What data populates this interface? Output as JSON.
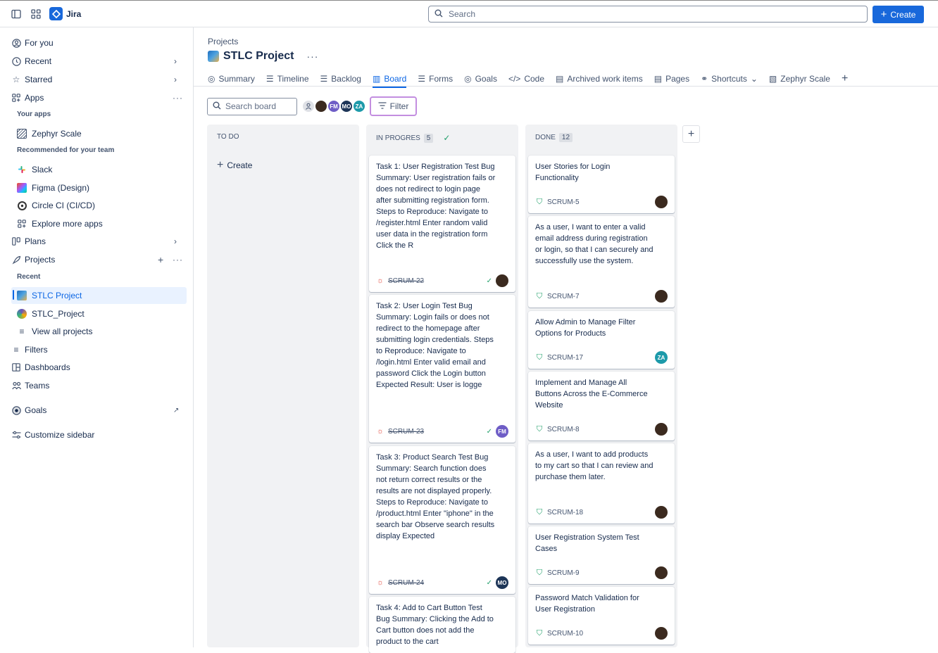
{
  "topbar": {
    "app_name": "Jira",
    "search_placeholder": "Search",
    "create_label": "Create"
  },
  "sidebar": {
    "items": {
      "for_you": "For you",
      "recent": "Recent",
      "starred": "Starred",
      "apps": "Apps",
      "your_apps_heading": "Your apps",
      "zephyr": "Zephyr Scale",
      "recommended_heading": "Recommended for your team",
      "slack": "Slack",
      "figma": "Figma (Design)",
      "circle": "Circle CI (CI/CD)",
      "explore": "Explore more apps",
      "plans": "Plans",
      "projects": "Projects",
      "recent_heading": "Recent",
      "stlc_project": "STLC Project",
      "stlc_project2": "STLC_Project",
      "view_all": "View all projects",
      "filters": "Filters",
      "dashboards": "Dashboards",
      "teams": "Teams",
      "goals": "Goals",
      "customize": "Customize sidebar"
    }
  },
  "header": {
    "breadcrumb": "Projects",
    "title": "STLC Project",
    "tabs": [
      "Summary",
      "Timeline",
      "Backlog",
      "Board",
      "Forms",
      "Goals",
      "Code",
      "Archived work items",
      "Pages",
      "Shortcuts",
      "Zephyr Scale"
    ],
    "active_tab": "Board"
  },
  "toolbar": {
    "search_placeholder": "Search board",
    "avatars": [
      "FM",
      "MO",
      "ZA"
    ],
    "filter_label": "Filter"
  },
  "board": {
    "columns": [
      {
        "title": "TO DO",
        "count": "",
        "create_label": "Create"
      },
      {
        "title": "IN PROGRES",
        "count": "5"
      },
      {
        "title": "DONE",
        "count": "12"
      }
    ],
    "in_progress_cards": [
      {
        "summary": "Task 1: User Registration Test Bug Summary: User registration fails or does not redirect to login page after submitting registration form. Steps to Reproduce: Navigate to /register.html Enter random valid user data in the registration form Click the R",
        "key": "SCRUM-22",
        "assignee": ""
      },
      {
        "summary": "Task 2: User Login Test Bug Summary: Login fails or does not redirect to the homepage after submitting login credentials. Steps to Reproduce: Navigate to /login.html Enter valid email and password Click the Login button Expected Result: User is logge",
        "key": "SCRUM-23",
        "assignee": "FM"
      },
      {
        "summary": "Task 3: Product Search Test Bug Summary: Search function does not return correct results or the results are not displayed properly. Steps to Reproduce: Navigate to /product.html Enter \"iphone\" in the search bar Observe search results display Expected",
        "key": "SCRUM-24",
        "assignee": "MO"
      },
      {
        "summary": "Task 4: Add to Cart Button Test Bug Summary: Clicking the Add to Cart button does not add the product to the cart",
        "key": "",
        "assignee": ""
      }
    ],
    "done_cards": [
      {
        "summary": "User Stories for Login Functionality",
        "key": "SCRUM-5",
        "assignee": ""
      },
      {
        "summary": "As a user, I want to enter a valid email address during registration or login, so that I can securely and successfully use the system.",
        "key": "SCRUM-7",
        "assignee": ""
      },
      {
        "summary": "Allow Admin to Manage Filter Options for Products",
        "key": "SCRUM-17",
        "assignee": "ZA"
      },
      {
        "summary": "Implement and Manage All Buttons Across the E-Commerce Website",
        "key": "SCRUM-8",
        "assignee": ""
      },
      {
        "summary": "As a user, I want to add products to my cart so that I can review and purchase them later.",
        "key": "SCRUM-18",
        "assignee": ""
      },
      {
        "summary": "User Registration System Test Cases",
        "key": "SCRUM-9",
        "assignee": ""
      },
      {
        "summary": "Password Match Validation for User Registration",
        "key": "SCRUM-10",
        "assignee": ""
      }
    ]
  },
  "colors": {
    "accent": "#1868db",
    "bug": "#e2483d",
    "story": "#22a06b",
    "filter_border": "#c38ee0"
  }
}
